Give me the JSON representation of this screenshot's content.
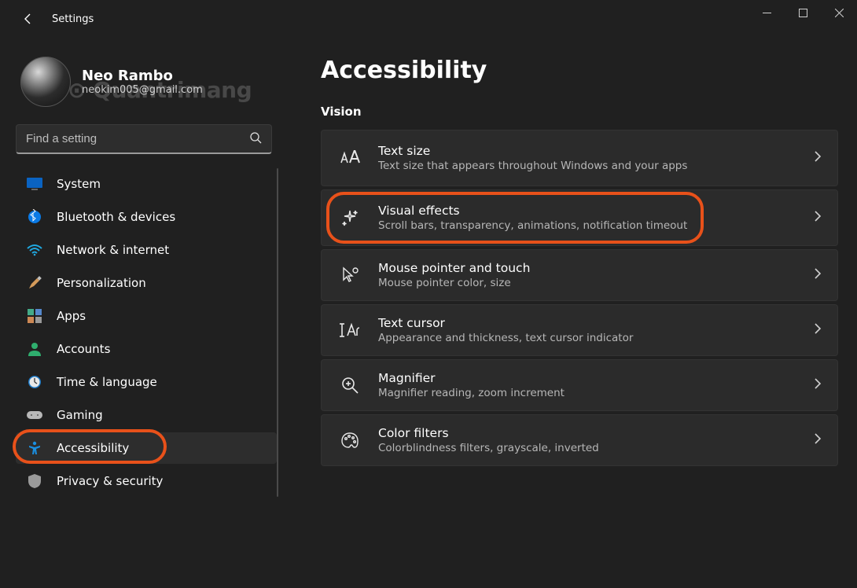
{
  "window": {
    "title": "Settings"
  },
  "profile": {
    "name": "Neo Rambo",
    "email": "neokim005@gmail.com",
    "watermark": "⊙ Quantrimang"
  },
  "search": {
    "placeholder": "Find a setting"
  },
  "nav": {
    "items": [
      {
        "id": "system",
        "label": "System",
        "selected": false
      },
      {
        "id": "bluetooth",
        "label": "Bluetooth & devices",
        "selected": false
      },
      {
        "id": "network",
        "label": "Network & internet",
        "selected": false
      },
      {
        "id": "personalization",
        "label": "Personalization",
        "selected": false
      },
      {
        "id": "apps",
        "label": "Apps",
        "selected": false
      },
      {
        "id": "accounts",
        "label": "Accounts",
        "selected": false
      },
      {
        "id": "time",
        "label": "Time & language",
        "selected": false
      },
      {
        "id": "gaming",
        "label": "Gaming",
        "selected": false
      },
      {
        "id": "accessibility",
        "label": "Accessibility",
        "selected": true,
        "highlighted": true
      },
      {
        "id": "privacy",
        "label": "Privacy & security",
        "selected": false
      }
    ]
  },
  "page": {
    "title": "Accessibility",
    "section": "Vision",
    "cards": [
      {
        "id": "text-size",
        "title": "Text size",
        "sub": "Text size that appears throughout Windows and your apps"
      },
      {
        "id": "visual-effects",
        "title": "Visual effects",
        "sub": "Scroll bars, transparency, animations, notification timeout",
        "highlighted": true
      },
      {
        "id": "mouse-pointer",
        "title": "Mouse pointer and touch",
        "sub": "Mouse pointer color, size"
      },
      {
        "id": "text-cursor",
        "title": "Text cursor",
        "sub": "Appearance and thickness, text cursor indicator"
      },
      {
        "id": "magnifier",
        "title": "Magnifier",
        "sub": "Magnifier reading, zoom increment"
      },
      {
        "id": "color-filters",
        "title": "Color filters",
        "sub": "Colorblindness filters, grayscale, inverted"
      }
    ]
  }
}
